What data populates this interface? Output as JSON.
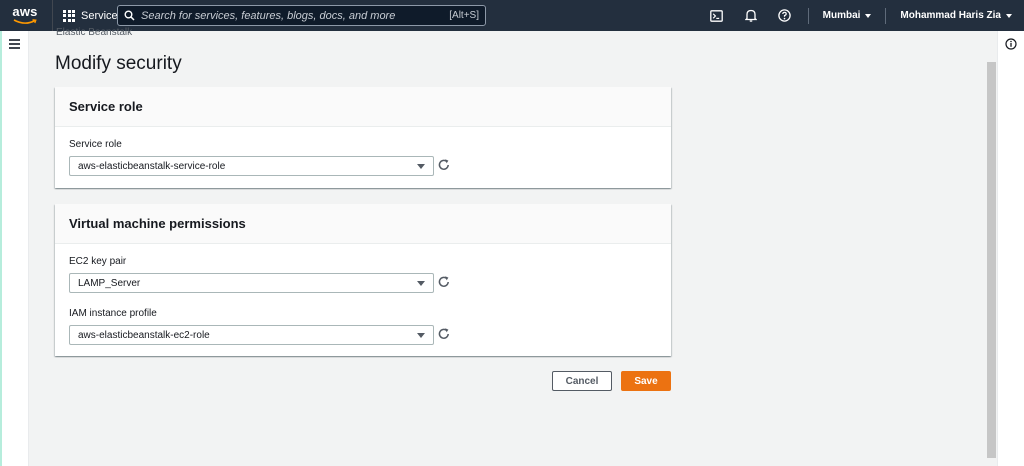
{
  "nav": {
    "logo_text": "aws",
    "services_label": "Services",
    "search_placeholder": "Search for services, features, blogs, docs, and more",
    "search_shortcut": "[Alt+S]",
    "region": "Mumbai",
    "account": "Mohammad Haris Zia"
  },
  "breadcrumb": "Elastic Beanstalk",
  "page_title": "Modify security",
  "service_role_card": {
    "title": "Service role",
    "field_label": "Service role",
    "field_value": "aws-elasticbeanstalk-service-role"
  },
  "vm_card": {
    "title": "Virtual machine permissions",
    "ec2_label": "EC2 key pair",
    "ec2_value": "LAMP_Server",
    "iam_label": "IAM instance profile",
    "iam_value": "aws-elasticbeanstalk-ec2-role"
  },
  "actions": {
    "cancel": "Cancel",
    "save": "Save"
  },
  "colors": {
    "nav_bg": "#232f3e",
    "primary": "#ec7211",
    "page_bg": "#f2f3f3"
  }
}
